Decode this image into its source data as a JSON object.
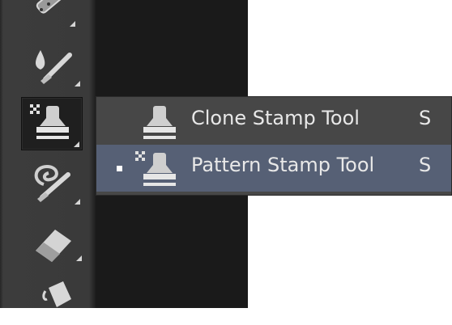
{
  "toolbar": {
    "tools": [
      {
        "name": "brush-tool",
        "icon": "brush-icon"
      },
      {
        "name": "mixer-brush-tool",
        "icon": "mixer-brush-icon"
      },
      {
        "name": "pattern-stamp-tool",
        "icon": "pattern-stamp-icon",
        "active": true
      },
      {
        "name": "history-brush-tool",
        "icon": "art-history-brush-icon"
      },
      {
        "name": "eraser-tool",
        "icon": "eraser-icon"
      },
      {
        "name": "paint-bucket-tool",
        "icon": "paint-bucket-icon"
      }
    ]
  },
  "flyout": {
    "items": [
      {
        "label": "Clone Stamp Tool",
        "shortcut": "S",
        "icon": "clone-stamp-icon",
        "selected": false
      },
      {
        "label": "Pattern Stamp Tool",
        "shortcut": "S",
        "icon": "pattern-stamp-icon",
        "selected": true
      }
    ]
  },
  "colors": {
    "toolbar_bg": "#3a3a3a",
    "flyout_bg": "#474747",
    "selected_bg": "#566075",
    "text": "#e8e8e8",
    "canvas": "#ffffff"
  }
}
